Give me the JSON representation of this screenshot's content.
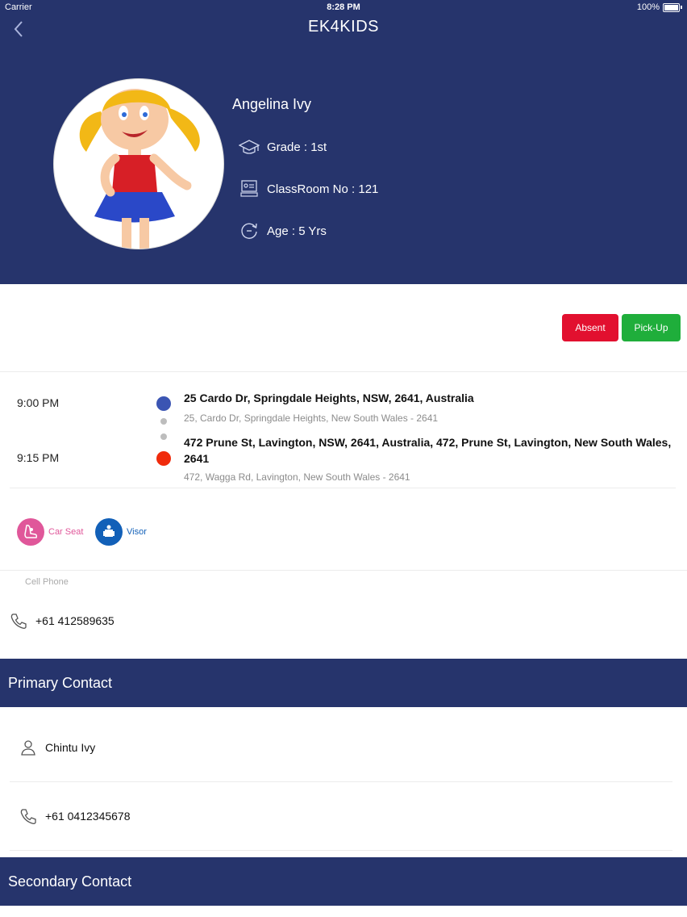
{
  "status_bar": {
    "carrier": "Carrier",
    "time": "8:28 PM",
    "battery": "100%"
  },
  "header": {
    "title": "EK4KIDS"
  },
  "student": {
    "name": "Angelina Ivy",
    "grade": "Grade : 1st",
    "classroom": "ClassRoom No : 121",
    "age": "Age : 5 Yrs"
  },
  "actions": {
    "absent_label": "Absent",
    "pickup_label": "Pick-Up"
  },
  "route": {
    "start": {
      "time": "9:00 PM",
      "address": "25 Cardo Dr, Springdale Heights, NSW, 2641, Australia",
      "detail": "25, Cardo Dr, Springdale Heights, New South Wales - 2641"
    },
    "end": {
      "time": "9:15 PM",
      "address": "472 Prune St, Lavington, NSW, 2641, Australia, 472, Prune St, Lavington, New South Wales, 2641",
      "detail": "472, Wagga Rd, Lavington, New South Wales - 2641"
    }
  },
  "features": [
    {
      "label": "Car Seat",
      "icon": "car-seat-icon",
      "color": "#e0579a"
    },
    {
      "label": "Visor",
      "icon": "visor-icon",
      "color": "#1260b8"
    }
  ],
  "cell_phone": {
    "label": "Cell Phone",
    "number": "+61 412589635"
  },
  "primary_contact": {
    "heading": "Primary Contact",
    "name": "Chintu Ivy",
    "phone": "+61 0412345678"
  },
  "secondary_contact": {
    "heading": "Secondary Contact"
  },
  "colors": {
    "brand": "#26346c",
    "absent": "#e2102f",
    "pickup": "#1fae3b",
    "start_dot": "#3b55b3",
    "end_dot": "#f02b0c"
  }
}
